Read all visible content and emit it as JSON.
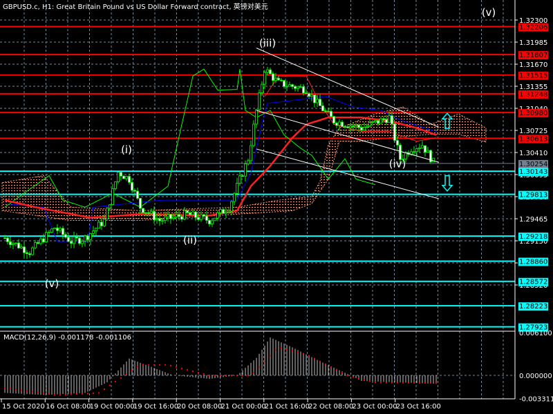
{
  "header": {
    "title": "GBPUSD.c, H1:  Great Britain Pound vs US Dollar Forward contract, 英镑对美元"
  },
  "macd_label": "MACD(12,26,9) -0.001178 -0.001106",
  "colors": {
    "bg": "#000000",
    "grid": "#778899",
    "candle": "#00ff00",
    "resistance": "#ff0000",
    "support": "#00ffff",
    "cloud": "#ffa07a",
    "ma": "#ff2020",
    "kijun": "#0000ff",
    "chikou": "#00ff00",
    "channel": "#ffffff",
    "current": "#708090"
  },
  "chart_data": {
    "type": "candlestick",
    "symbol": "GBPUSD.c",
    "timeframe": "H1",
    "price_axis": {
      "ylim": [
        1.278,
        1.325
      ],
      "ticks": [
        "1.32300",
        "1.31985",
        "1.31670",
        "1.31355",
        "1.31040",
        "1.30725",
        "1.30410",
        "1.30095",
        "1.29780",
        "1.29465",
        "1.29150",
        "1.28835",
        "1.28520"
      ]
    },
    "x_labels": [
      "15 Oct 2020",
      "16 Oct 08:00",
      "19 Oct 00:00",
      "19 Oct 16:00",
      "20 Oct 08:00",
      "21 Oct 00:00",
      "21 Oct 16:00",
      "22 Oct 08:00",
      "23 Oct 00:00",
      "23 Oct 16:00"
    ],
    "current_price": "1.30254",
    "resistance_levels": [
      "1.32206",
      "1.31807",
      "1.31515",
      "1.31248",
      "1.30980",
      "1.30613"
    ],
    "support_levels": [
      "1.30143",
      "1.29813",
      "1.29218",
      "1.28860",
      "1.28572",
      "1.28223",
      "1.27923"
    ],
    "close_keypoints": [
      [
        1,
        1.2919
      ],
      [
        10,
        1.2899
      ],
      [
        19,
        1.2934
      ],
      [
        25,
        1.2914
      ],
      [
        30,
        1.2919
      ],
      [
        37,
        1.2944
      ],
      [
        42,
        1.3013
      ],
      [
        46,
        1.3003
      ],
      [
        50,
        1.2963
      ],
      [
        57,
        1.2944
      ],
      [
        67,
        1.2953
      ],
      [
        75,
        1.2944
      ],
      [
        82,
        1.2963
      ],
      [
        89,
        1.3032
      ],
      [
        92,
        1.3101
      ],
      [
        95,
        1.316
      ],
      [
        100,
        1.314
      ],
      [
        110,
        1.3131
      ],
      [
        114,
        1.3111
      ],
      [
        120,
        1.3086
      ],
      [
        130,
        1.3076
      ],
      [
        140,
        1.3091
      ],
      [
        144,
        1.3032
      ],
      [
        148,
        1.3047
      ],
      [
        152,
        1.3052
      ],
      [
        156,
        1.3027
      ]
    ],
    "cloud_top": [
      [
        0,
        1.2998
      ],
      [
        15,
        1.3008
      ],
      [
        25,
        1.2963
      ],
      [
        50,
        1.2958
      ],
      [
        85,
        1.2963
      ],
      [
        100,
        1.2973
      ],
      [
        112,
        1.2978
      ],
      [
        115,
        1.3
      ],
      [
        118,
        1.3052
      ],
      [
        122,
        1.3076
      ],
      [
        135,
        1.3096
      ],
      [
        145,
        1.3106
      ],
      [
        155,
        1.3081
      ],
      [
        165,
        1.3096
      ],
      [
        175,
        1.3076
      ]
    ],
    "cloud_bottom": [
      [
        0,
        1.2958
      ],
      [
        25,
        1.2944
      ],
      [
        50,
        1.2944
      ],
      [
        85,
        1.2953
      ],
      [
        105,
        1.2958
      ],
      [
        112,
        1.2968
      ],
      [
        118,
        1.3003
      ],
      [
        122,
        1.3057
      ],
      [
        130,
        1.3057
      ],
      [
        140,
        1.3062
      ],
      [
        155,
        1.3067
      ],
      [
        165,
        1.3067
      ],
      [
        175,
        1.3056
      ]
    ],
    "chikou": [
      [
        1,
        1.2963
      ],
      [
        8,
        1.2983
      ],
      [
        17,
        1.3008
      ],
      [
        22,
        1.2973
      ],
      [
        30,
        1.2963
      ],
      [
        40,
        1.2983
      ],
      [
        50,
        1.2963
      ],
      [
        60,
        1.2993
      ],
      [
        65,
        1.3081
      ],
      [
        69,
        1.315
      ],
      [
        73,
        1.316
      ],
      [
        78,
        1.313
      ],
      [
        85,
        1.3131
      ],
      [
        86,
        1.316
      ],
      [
        88,
        1.3101
      ],
      [
        92,
        1.3091
      ],
      [
        97,
        1.3101
      ],
      [
        102,
        1.3066
      ],
      [
        108,
        1.3047
      ],
      [
        112,
        1.3037
      ],
      [
        118,
        1.3003
      ],
      [
        124,
        1.3032
      ],
      [
        128,
        1.3003
      ],
      [
        135,
        1.2995
      ]
    ],
    "ma": [
      [
        1,
        1.2973
      ],
      [
        12,
        1.2963
      ],
      [
        32,
        1.2948
      ],
      [
        50,
        1.2953
      ],
      [
        75,
        1.2951
      ],
      [
        85,
        1.2958
      ],
      [
        90,
        1.2993
      ],
      [
        97,
        1.3022
      ],
      [
        105,
        1.3062
      ],
      [
        110,
        1.3081
      ],
      [
        118,
        1.3091
      ],
      [
        130,
        1.3091
      ],
      [
        140,
        1.3086
      ],
      [
        150,
        1.3076
      ],
      [
        157,
        1.3066
      ]
    ],
    "kijun": [
      [
        1,
        1.2968
      ],
      [
        15,
        1.2963
      ],
      [
        20,
        1.2914
      ],
      [
        31,
        1.2914
      ],
      [
        33,
        1.2963
      ],
      [
        58,
        1.2973
      ],
      [
        85,
        1.2973
      ],
      [
        90,
        1.3012
      ],
      [
        94,
        1.3081
      ],
      [
        96,
        1.3111
      ],
      [
        117,
        1.3121
      ],
      [
        127,
        1.3106
      ],
      [
        137,
        1.3101
      ],
      [
        145,
        1.3086
      ],
      [
        157,
        1.3071
      ]
    ],
    "tenkan": [
      [
        95,
        1.3121
      ],
      [
        100,
        1.315
      ],
      [
        110,
        1.315
      ],
      [
        115,
        1.3111
      ],
      [
        120,
        1.3081
      ],
      [
        130,
        1.3071
      ],
      [
        140,
        1.3071
      ],
      [
        150,
        1.3057
      ],
      [
        157,
        1.3062
      ]
    ],
    "channel": [
      [
        [
          92,
          1.319
        ],
        [
          158,
          1.3077
        ]
      ],
      [
        [
          92,
          1.3101
        ],
        [
          158,
          1.3027
        ]
      ],
      [
        [
          92,
          1.3046
        ],
        [
          158,
          1.2975
        ]
      ]
    ],
    "waves": [
      {
        "label": "(v)",
        "bar": 176,
        "price": 1.3236
      },
      {
        "label": "(iii)",
        "bar": 96,
        "price": 1.3192
      },
      {
        "label": "(i)",
        "bar": 45,
        "price": 1.304
      },
      {
        "label": "(ii)",
        "bar": 68,
        "price": 1.2911
      },
      {
        "label": "(v)",
        "bar": 18,
        "price": 1.2849
      },
      {
        "label": "(iv)",
        "bar": 143,
        "price": 1.302
      }
    ],
    "arrows": [
      {
        "dir": "up",
        "bar": 161,
        "price": 1.3085
      },
      {
        "dir": "down",
        "bar": 161,
        "price": 1.2998
      }
    ],
    "macd": {
      "params": "12,26,9",
      "value": -0.001178,
      "signal_value": -0.001106,
      "ylim": [
        -0.003311,
        0.0061
      ],
      "ticks": [
        "0.006100",
        "0.000000",
        "-0.003311"
      ],
      "histogram": [
        [
          1,
          -0.0025
        ],
        [
          15,
          -0.0028
        ],
        [
          30,
          -0.0025
        ],
        [
          38,
          -0.001
        ],
        [
          46,
          0.0024
        ],
        [
          52,
          0.0015
        ],
        [
          62,
          0.0
        ],
        [
          75,
          -0.0005
        ],
        [
          85,
          0.0
        ],
        [
          92,
          0.0025
        ],
        [
          97,
          0.0054
        ],
        [
          105,
          0.004
        ],
        [
          115,
          0.002
        ],
        [
          125,
          0.0002
        ],
        [
          130,
          -0.0008
        ],
        [
          157,
          -0.0012
        ]
      ],
      "signal": [
        [
          1,
          -0.0018
        ],
        [
          20,
          -0.0028
        ],
        [
          35,
          -0.0025
        ],
        [
          50,
          0.0015
        ],
        [
          60,
          0.0015
        ],
        [
          75,
          0.0
        ],
        [
          90,
          0.0
        ],
        [
          100,
          0.004
        ],
        [
          110,
          0.003
        ],
        [
          125,
          0.0
        ],
        [
          135,
          -0.001
        ],
        [
          157,
          -0.0011
        ]
      ]
    }
  }
}
